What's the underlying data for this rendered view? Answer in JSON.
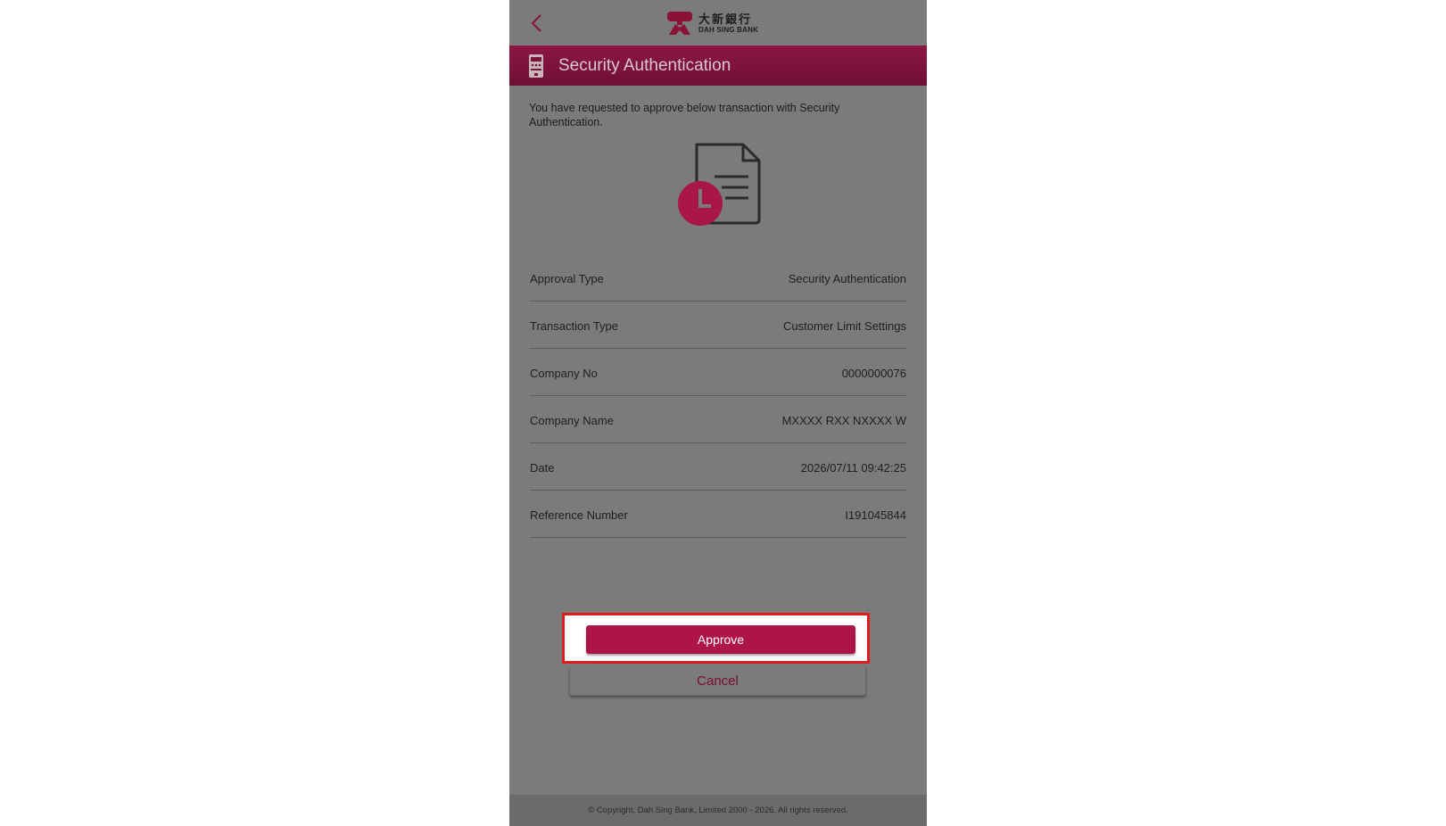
{
  "header": {
    "logo_cn": "大新銀行",
    "logo_en": "DAH SING BANK"
  },
  "page_title": "Security Authentication",
  "intro_text": "You have requested to approve below transaction with Security Authentication.",
  "details": [
    {
      "label": "Approval Type",
      "value": "Security Authentication"
    },
    {
      "label": "Transaction Type",
      "value": "Customer Limit Settings"
    },
    {
      "label": "Company No",
      "value": "0000000076"
    },
    {
      "label": "Company Name",
      "value": "MXXXX RXX NXXXX W"
    },
    {
      "label": "Date",
      "value": "2026/07/11 09:42:25"
    },
    {
      "label": "Reference Number",
      "value": "I191045844"
    }
  ],
  "actions": {
    "approve_label": "Approve",
    "cancel_label": "Cancel"
  },
  "footer_text": "© Copyright. Dah Sing Bank, Limited 2000 - 2026. All rights reserved.",
  "colors": {
    "brand": "#ad1547",
    "overlay_gray": "#7b7b7b",
    "highlight_red": "#e01b1b"
  }
}
